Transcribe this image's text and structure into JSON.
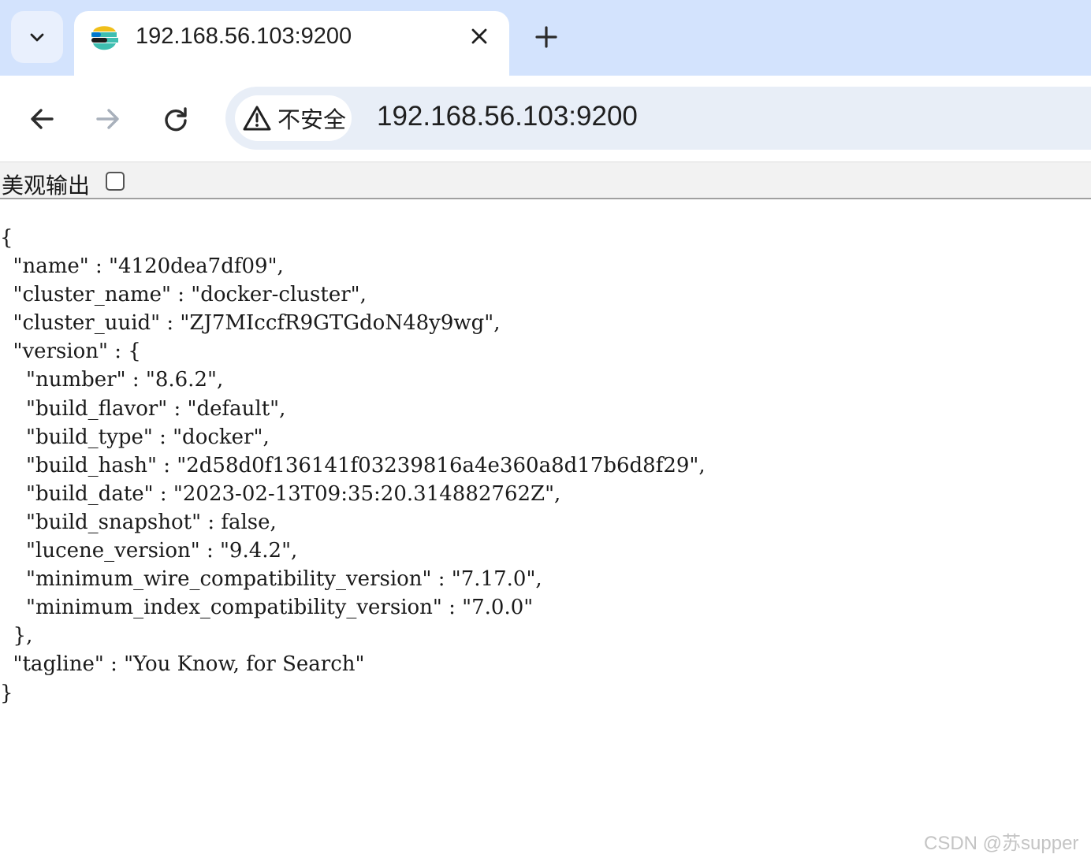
{
  "tab": {
    "title": "192.168.56.103:9200"
  },
  "toolbar": {
    "security_label": "不安全",
    "url": "192.168.56.103:9200"
  },
  "pretty_print": {
    "label": "美观输出",
    "checked": false
  },
  "json_lines": [
    "{",
    "  \"name\" : \"4120dea7df09\",",
    "  \"cluster_name\" : \"docker-cluster\",",
    "  \"cluster_uuid\" : \"ZJ7MIccfR9GTGdoN48y9wg\",",
    "  \"version\" : {",
    "    \"number\" : \"8.6.2\",",
    "    \"build_flavor\" : \"default\",",
    "    \"build_type\" : \"docker\",",
    "    \"build_hash\" : \"2d58d0f136141f03239816a4e360a8d17b6d8f29\",",
    "    \"build_date\" : \"2023-02-13T09:35:20.314882762Z\",",
    "    \"build_snapshot\" : false,",
    "    \"lucene_version\" : \"9.4.2\",",
    "    \"minimum_wire_compatibility_version\" : \"7.17.0\",",
    "    \"minimum_index_compatibility_version\" : \"7.0.0\"",
    "  },",
    "  \"tagline\" : \"You Know, for Search\"",
    "}"
  ],
  "watermark": "CSDN @苏supper",
  "icons": {
    "tab_search": "chevron-down-icon",
    "favicon": "elastic-logo-icon",
    "close": "close-icon",
    "new_tab": "plus-icon",
    "back": "arrow-left-icon",
    "forward": "arrow-right-icon",
    "reload": "reload-icon",
    "security": "warning-triangle-icon"
  },
  "colors": {
    "tabstrip": "#d3e3fd",
    "omnibox": "#e8eef7",
    "forward_disabled": "#a8b0bb"
  }
}
